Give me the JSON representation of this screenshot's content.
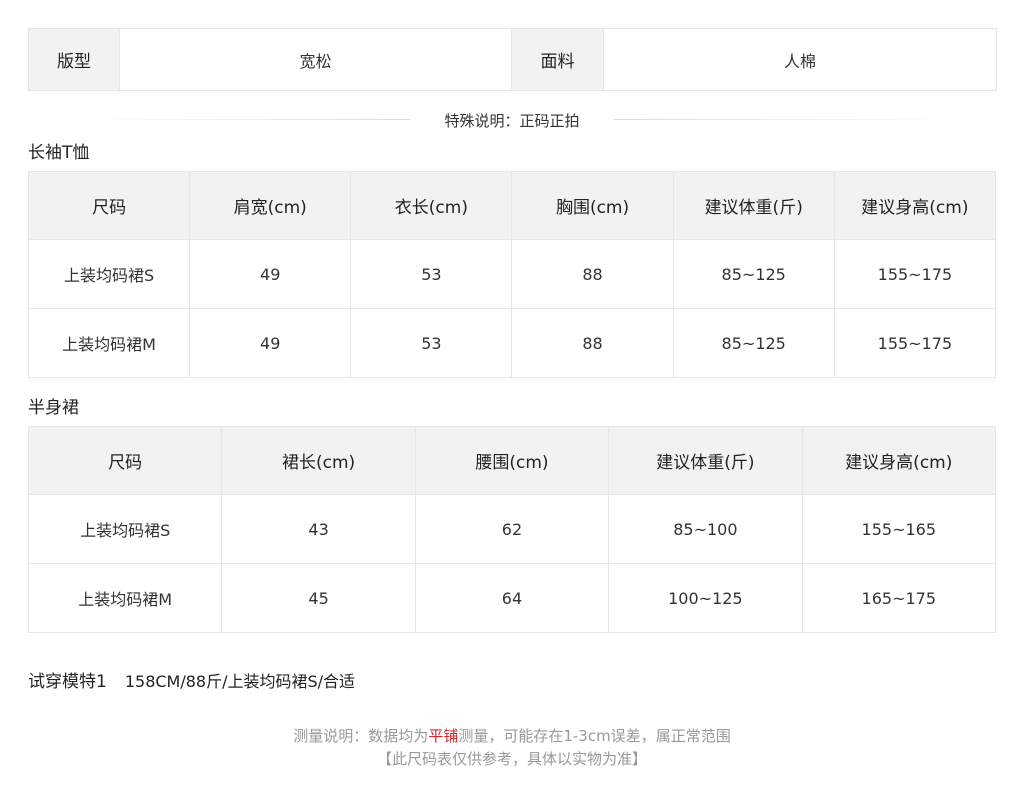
{
  "attributes": {
    "fit_label": "版型",
    "fit_value": "宽松",
    "fabric_label": "面料",
    "fabric_value": "人棉"
  },
  "special_note": "特殊说明：正码正拍",
  "top_table": {
    "title": "长袖T恤",
    "headers": [
      "尺码",
      "肩宽(cm)",
      "衣长(cm)",
      "胸围(cm)",
      "建议体重(斤)",
      "建议身高(cm)"
    ],
    "rows": [
      [
        "上装均码裙S",
        "49",
        "53",
        "88",
        "85~125",
        "155~175"
      ],
      [
        "上装均码裙M",
        "49",
        "53",
        "88",
        "85~125",
        "155~175"
      ]
    ]
  },
  "skirt_table": {
    "title": "半身裙",
    "headers": [
      "尺码",
      "裙长(cm)",
      "腰围(cm)",
      "建议体重(斤)",
      "建议身高(cm)"
    ],
    "rows": [
      [
        "上装均码裙S",
        "43",
        "62",
        "85~100",
        "155~165"
      ],
      [
        "上装均码裙M",
        "45",
        "64",
        "100~125",
        "165~175"
      ]
    ]
  },
  "model": {
    "label": "试穿模特1",
    "value": "158CM/88斤/上装均码裙S/合适"
  },
  "footer": {
    "line1_a": "测量说明：数据均为",
    "line1_highlight": "平铺",
    "line1_b": "测量，可能存在1-3cm误差，属正常范围",
    "line2": "【此尺码表仅供参考，具体以实物为准】",
    "highlight_color": "#d0272a"
  }
}
